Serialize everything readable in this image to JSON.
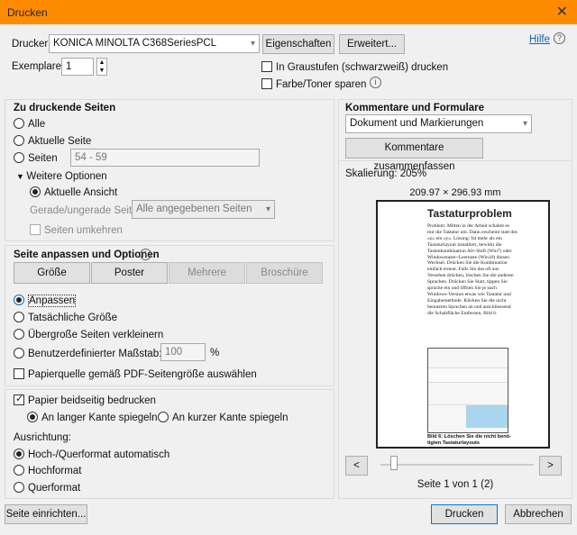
{
  "window": {
    "title": "Drucken",
    "close": "✕"
  },
  "printer": {
    "label": "Drucker:",
    "value": "KONICA MINOLTA C368SeriesPCL",
    "properties": "Eigenschaften",
    "advanced": "Erweitert...",
    "help": "Hilfe"
  },
  "copies": {
    "label": "Exemplare:",
    "value": "1"
  },
  "options": {
    "grayscale": "In Graustufen (schwarzweiß) drucken",
    "save_toner": "Farbe/Toner sparen"
  },
  "pages": {
    "heading": "Zu druckende Seiten",
    "all": "Alle",
    "current": "Aktuelle Seite",
    "range": "Seiten",
    "range_value": "54 - 59",
    "more": "Weitere Optionen",
    "current_view": "Aktuelle Ansicht",
    "odd_even_label": "Gerade/ungerade Seiten:",
    "odd_even_value": "Alle angegebenen Seiten",
    "reverse": "Seiten umkehren"
  },
  "fit": {
    "heading": "Seite anpassen und Optionen",
    "size": "Größe",
    "poster": "Poster",
    "multiple": "Mehrere",
    "booklet": "Broschüre",
    "fit": "Anpassen",
    "actual": "Tatsächliche Größe",
    "shrink": "Übergroße Seiten verkleinern",
    "custom": "Benutzerdefinierter Maßstab:",
    "custom_value": "100",
    "percent": "%",
    "paper_source": "Papierquelle gemäß PDF-Seitengröße auswählen"
  },
  "duplex": {
    "label": "Papier beidseitig bedrucken",
    "long": "An langer Kante spiegeln",
    "short": "An kurzer Kante spiegeln"
  },
  "orientation": {
    "label": "Ausrichtung:",
    "auto": "Hoch-/Querformat automatisch",
    "portrait": "Hochformat",
    "landscape": "Querformat"
  },
  "comments": {
    "heading": "Kommentare und Formulare",
    "value": "Dokument und Markierungen",
    "summarize": "Kommentare zusammenfassen"
  },
  "preview": {
    "scale": "Skalierung: 205%",
    "dimensions": "209.97 × 296.93 mm",
    "page_title": "Tastaturproblem",
    "page_body": "Problem: Mitten in der Arbeit schaltet es mir die Tastatur um. Dann erscheint statt des «z» ein «y». Lösung: Ist mehr als ein Tastaturlayout installiert, bewirkt die Tastenkombination Alt+Shift (Win7) oder Windowstaste+Leertaste (Win10) diesen Wechsel. Drücken Sie die Kombination einfach erneut. Falls Sie das oft aus Versehen drücken, löschen Sie die anderen Sprachen. Drücken Sie Start, tippen Sie sprache ein und öffnen Sie je nach Windows-Version etwas wie Tastatur und Eingabemethode. Klicken Sie die nicht benutzten Sprachen an und anschliessend die Schaltfläche Entfernen, Bild 6.",
    "caption": "Bild 6: Löschen Sie die nicht benö-tigten Tastaturlayouts",
    "prev": "<",
    "next": ">",
    "page_info": "Seite 1 von 1 (2)"
  },
  "footer": {
    "setup": "Seite einrichten...",
    "print": "Drucken",
    "cancel": "Abbrechen"
  }
}
